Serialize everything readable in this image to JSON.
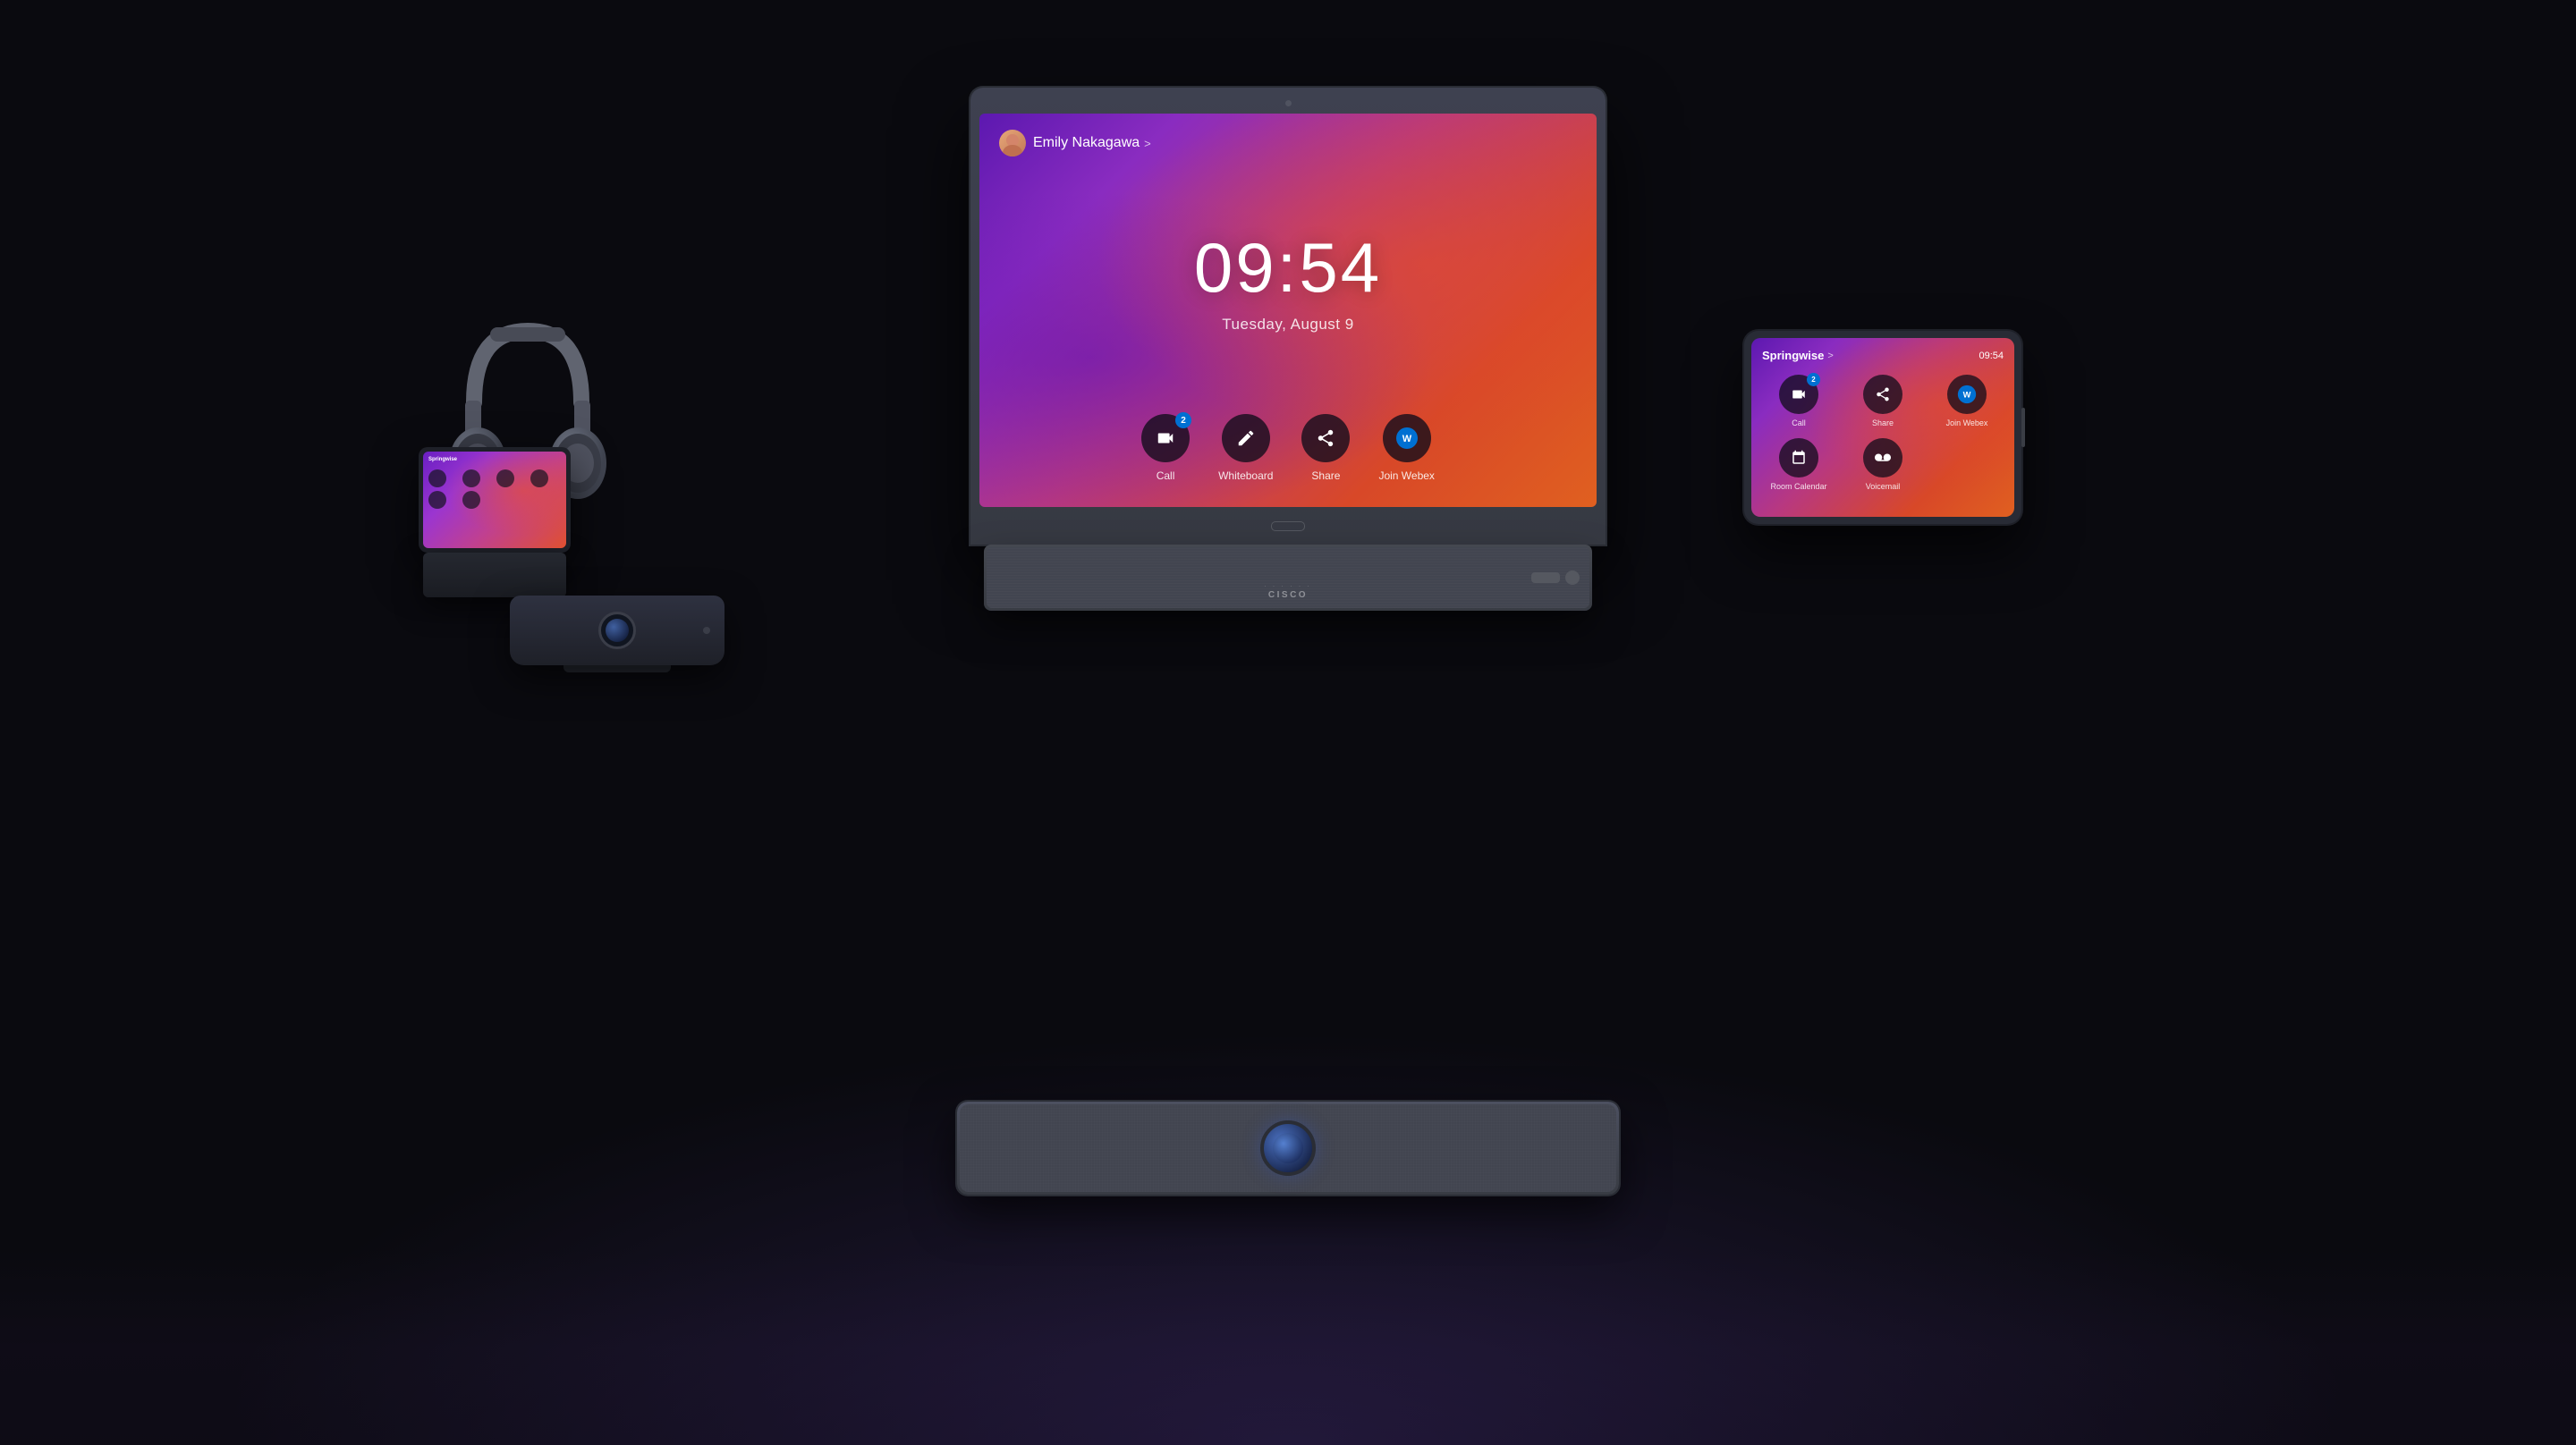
{
  "scene": {
    "background": "#0a0a0f"
  },
  "main_monitor": {
    "user_name": "Emily Nakagawa",
    "chevron": ">",
    "clock_time": "09:54",
    "clock_date": "Tuesday, August 9",
    "dock": [
      {
        "id": "call",
        "label": "Call",
        "badge": "2",
        "icon": "camera-icon"
      },
      {
        "id": "whiteboard",
        "label": "Whiteboard",
        "icon": "pencil-icon"
      },
      {
        "id": "share",
        "label": "Share",
        "icon": "share-icon"
      },
      {
        "id": "join_webex",
        "label": "Join Webex",
        "icon": "webex-icon"
      }
    ],
    "cisco_label": "cisco"
  },
  "tablet_right": {
    "room_name": "Springwise",
    "time": "09:54",
    "chevron": ">",
    "icons": [
      {
        "id": "call",
        "label": "Call",
        "badge": "2"
      },
      {
        "id": "share",
        "label": "Share"
      },
      {
        "id": "join_webex",
        "label": "Join Webex"
      },
      {
        "id": "room_calendar",
        "label": "Room Calendar"
      },
      {
        "id": "voicemail",
        "label": "Voicemail"
      }
    ]
  },
  "tablet_small": {
    "room_name": "Springwise"
  },
  "devices": {
    "headphones_present": true,
    "webcam_present": true,
    "soundbar_present": true
  }
}
